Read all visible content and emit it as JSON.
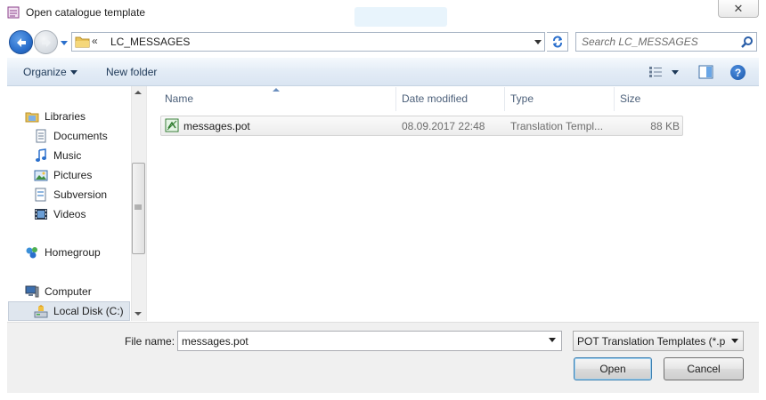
{
  "window": {
    "title": "Open catalogue template",
    "close_glyph": "✕",
    "icon": "catalogue-icon"
  },
  "nav": {
    "back_icon": "back-arrow-icon",
    "forward_icon": "forward-arrow-icon",
    "address_prefix": "«",
    "address_path": "LC_MESSAGES",
    "search_placeholder": "Search LC_MESSAGES"
  },
  "toolbar": {
    "organize_label": "Organize",
    "new_folder_label": "New folder",
    "help_glyph": "?"
  },
  "sidebar": {
    "items": [
      {
        "label": "Libraries",
        "icon": "libraries-icon"
      },
      {
        "label": "Documents",
        "icon": "documents-icon"
      },
      {
        "label": "Music",
        "icon": "music-icon"
      },
      {
        "label": "Pictures",
        "icon": "pictures-icon"
      },
      {
        "label": "Subversion",
        "icon": "subversion-icon"
      },
      {
        "label": "Videos",
        "icon": "videos-icon"
      },
      {
        "label": "Homegroup",
        "icon": "homegroup-icon"
      },
      {
        "label": "Computer",
        "icon": "computer-icon"
      },
      {
        "label": "Local Disk (C:)",
        "icon": "local-disk-icon"
      }
    ],
    "selected": "Local Disk (C:)"
  },
  "file_list": {
    "columns": [
      "Name",
      "Date modified",
      "Type",
      "Size"
    ],
    "sorted_column": "Name",
    "rows": [
      {
        "name": "messages.pot",
        "date": "08.09.2017 22:48",
        "type": "Translation Templ...",
        "size": "88 KB"
      }
    ]
  },
  "footer": {
    "file_name_label": "File name:",
    "file_name_value": "messages.pot",
    "file_type_filter": "POT Translation Templates (*.p",
    "open_label": "Open",
    "cancel_label": "Cancel"
  },
  "colors": {
    "accent": "#2a6fcc",
    "command_bar": "#dae5f2",
    "selection": "#dfe6ee"
  }
}
